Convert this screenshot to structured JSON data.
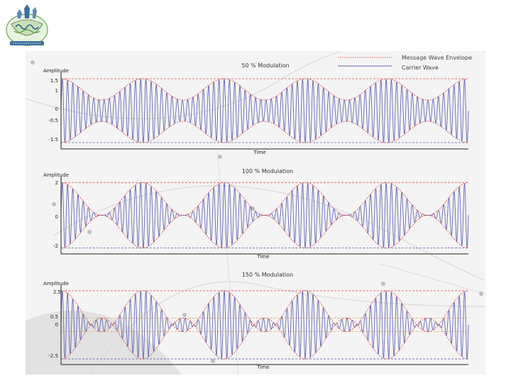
{
  "logo": {
    "icon": "university-crest-logo"
  },
  "legend": {
    "envelope_label": "Message Wave Envelope",
    "carrier_label": "Carrier Wave",
    "envelope_color": "#e05555",
    "carrier_color": "#6666b3"
  },
  "chart_data": [
    {
      "type": "line",
      "title": "50 % Modulation",
      "ylabel": "Amplitude",
      "xlabel": "Time",
      "yticks": [
        "1.5",
        "1",
        "0",
        "-0.5",
        "-1.5"
      ],
      "modulation_index": 0.5,
      "ylim": [
        -1.6,
        1.6
      ],
      "envelope_cycles": 5,
      "carrier_cycles": 78,
      "series": [
        {
          "name": "Message Wave Envelope",
          "formula": "±(1 + 0.5·cos(2π·5·t))"
        },
        {
          "name": "Carrier Wave",
          "formula": "(1 + 0.5·cos(2π·5·t))·sin(2π·78·t)"
        }
      ]
    },
    {
      "type": "line",
      "title": "100 % Modulation",
      "ylabel": "Amplitude",
      "xlabel": "Time",
      "yticks": [
        "2",
        "0",
        "-2"
      ],
      "modulation_index": 1.0,
      "ylim": [
        -2.1,
        2.1
      ],
      "envelope_cycles": 5,
      "carrier_cycles": 78,
      "series": [
        {
          "name": "Message Wave Envelope",
          "formula": "±(1 + cos(2π·5·t))"
        },
        {
          "name": "Carrier Wave",
          "formula": "(1 + cos(2π·5·t))·sin(2π·78·t)"
        }
      ]
    },
    {
      "type": "line",
      "title": "150 % Modulation",
      "ylabel": "Amplitude",
      "xlabel": "Time",
      "yticks": [
        "2.5",
        "0.5",
        "0",
        "-2.5"
      ],
      "modulation_index": 1.5,
      "ylim": [
        -2.6,
        2.6
      ],
      "envelope_cycles": 5,
      "carrier_cycles": 78,
      "series": [
        {
          "name": "Message Wave Envelope",
          "formula": "±(1 + 1.5·cos(2π·5·t))"
        },
        {
          "name": "Carrier Wave",
          "formula": "(1 + 1.5·cos(2π·5·t))·sin(2π·78·t)"
        }
      ]
    }
  ]
}
